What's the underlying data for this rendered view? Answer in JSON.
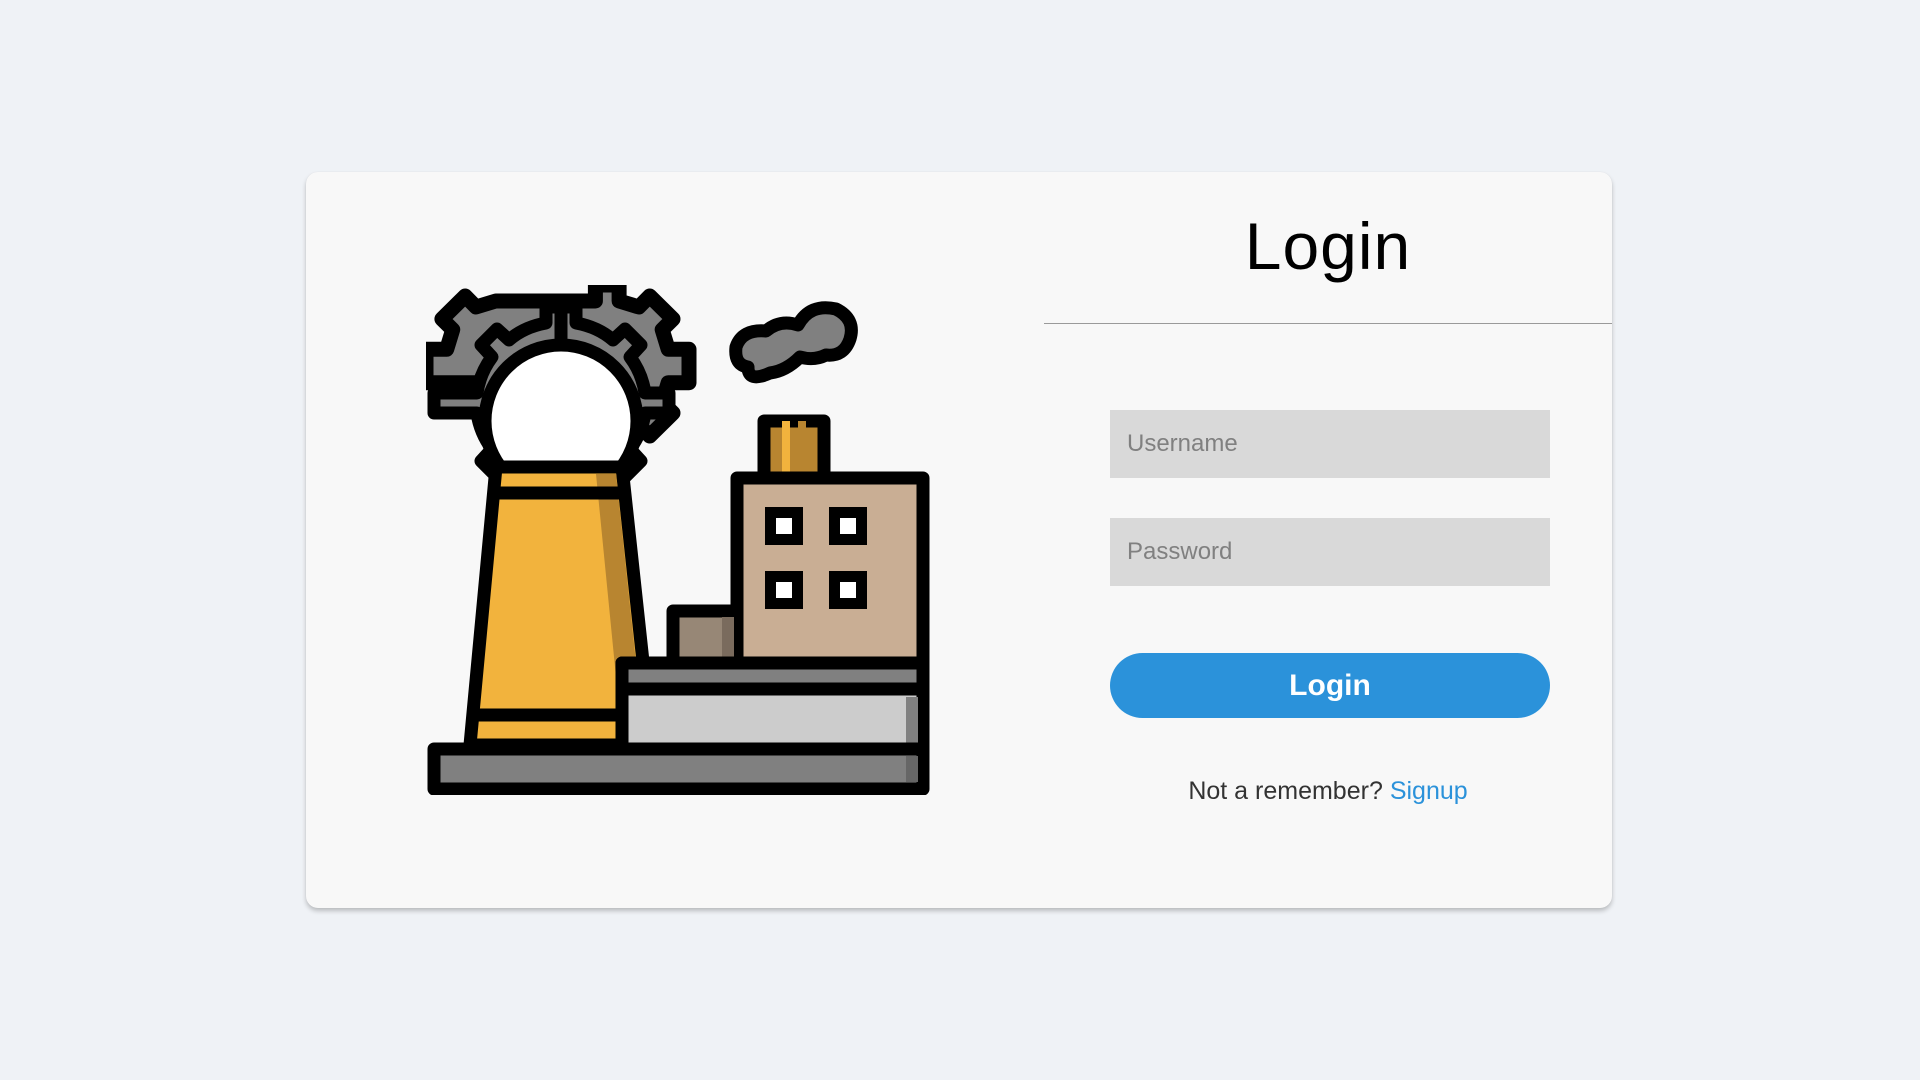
{
  "login_form": {
    "title": "Login",
    "username_placeholder": "Username",
    "username_value": "",
    "password_placeholder": "Password",
    "password_value": "",
    "submit_label": "Login",
    "signup_prompt": "Not a remember?",
    "signup_link": "Signup"
  },
  "illustration": {
    "icon": "factory-icon"
  },
  "colors": {
    "page_background": "#eff2f6",
    "card_background": "#f8f8f8",
    "input_background": "#d9d9d9",
    "accent": "#2b92da",
    "factory_yellow": "#f2b33d",
    "gear_gray": "#808080",
    "building_tan": "#c9ae94"
  }
}
